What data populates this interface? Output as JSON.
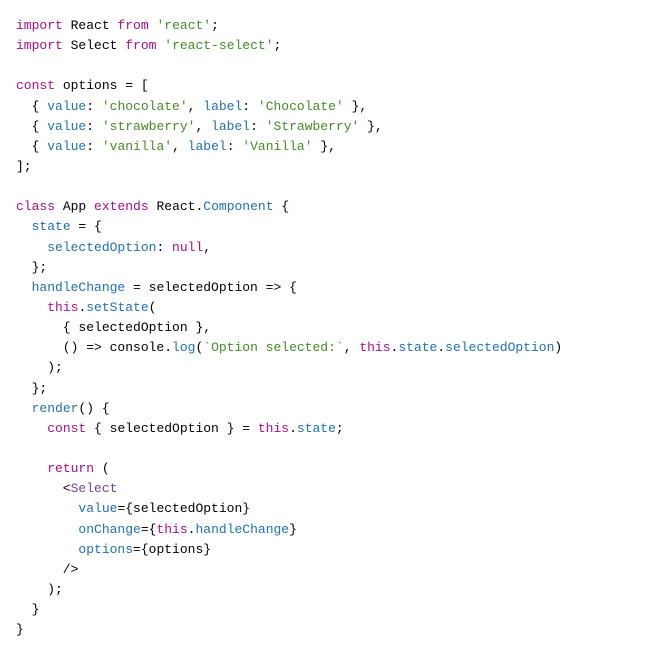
{
  "code": {
    "line01_import": "import",
    "line01_react": "React",
    "line01_from": "from",
    "line01_str": "'react'",
    "line02_import": "import",
    "line02_select": "Select",
    "line02_from": "from",
    "line02_str": "'react-select'",
    "line04_const": "const",
    "line04_options": "options",
    "line05_value": "value",
    "line05_val": "'chocolate'",
    "line05_label": "label",
    "line05_lab": "'Chocolate'",
    "line06_value": "value",
    "line06_val": "'strawberry'",
    "line06_label": "label",
    "line06_lab": "'Strawberry'",
    "line07_value": "value",
    "line07_val": "'vanilla'",
    "line07_label": "label",
    "line07_lab": "'Vanilla'",
    "line10_class": "class",
    "line10_app": "App",
    "line10_extends": "extends",
    "line10_react": "React",
    "line10_component": "Component",
    "line11_state": "state",
    "line12_selectedOption": "selectedOption",
    "line12_null": "null",
    "line14_handleChange": "handleChange",
    "line14_param": "selectedOption",
    "line15_this": "this",
    "line15_setState": "setState",
    "line16_selectedOption": "selectedOption",
    "line17_console": "console",
    "line17_log": "log",
    "line17_str": "`Option selected:`",
    "line17_this": "this",
    "line17_state": "state",
    "line17_selectedOption": "selectedOption",
    "line20_render": "render",
    "line21_const": "const",
    "line21_selectedOption": "selectedOption",
    "line21_this": "this",
    "line21_state": "state",
    "line23_return": "return",
    "line24_select": "Select",
    "line25_valueAttr": "value",
    "line25_selectedOption": "selectedOption",
    "line26_onChange": "onChange",
    "line26_this": "this",
    "line26_handleChange": "handleChange",
    "line27_optionsAttr": "options",
    "line27_options": "options"
  }
}
